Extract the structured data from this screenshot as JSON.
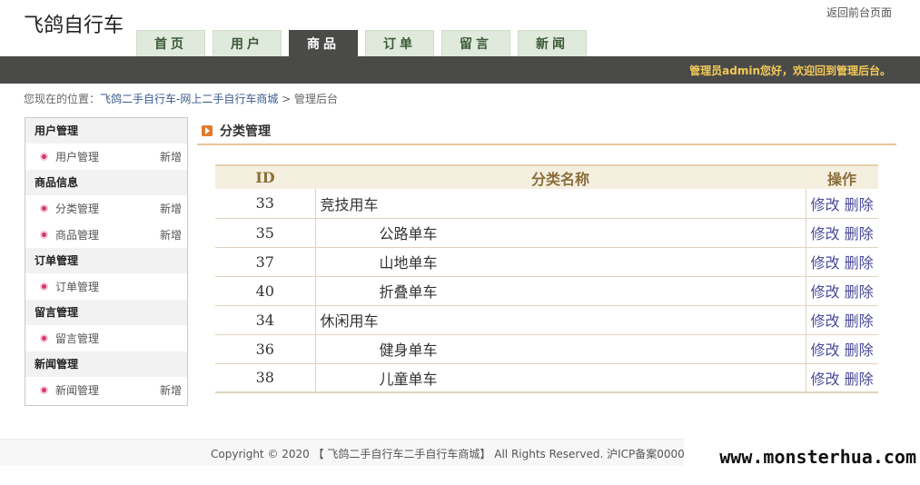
{
  "brand": "飞鸽自行车",
  "top_link": "返回前台页面",
  "nav": [
    {
      "label": "首页",
      "active": false
    },
    {
      "label": "用户",
      "active": false
    },
    {
      "label": "商品",
      "active": true
    },
    {
      "label": "订单",
      "active": false
    },
    {
      "label": "留言",
      "active": false
    },
    {
      "label": "新闻",
      "active": false
    }
  ],
  "welcome": "管理员admin您好，欢迎回到管理后台。",
  "breadcrumb": {
    "prefix": "您现在的位置：",
    "site": "飞鸽二手自行车-网上二手自行车商城",
    "sep": " > ",
    "current": "管理后台"
  },
  "sidebar": [
    {
      "group": "用户管理",
      "items": [
        {
          "label": "用户管理",
          "add": "新增"
        }
      ]
    },
    {
      "group": "商品信息",
      "items": [
        {
          "label": "分类管理",
          "add": "新增"
        },
        {
          "label": "商品管理",
          "add": "新增"
        }
      ]
    },
    {
      "group": "订单管理",
      "items": [
        {
          "label": "订单管理",
          "add": ""
        }
      ]
    },
    {
      "group": "留言管理",
      "items": [
        {
          "label": "留言管理",
          "add": ""
        }
      ]
    },
    {
      "group": "新闻管理",
      "items": [
        {
          "label": "新闻管理",
          "add": "新增"
        }
      ]
    }
  ],
  "section_title": "分类管理",
  "table": {
    "headers": [
      "ID",
      "分类名称",
      "操作"
    ],
    "rows": [
      {
        "id": "33",
        "name": "竞技用车",
        "sub": false
      },
      {
        "id": "35",
        "name": "公路单车",
        "sub": true
      },
      {
        "id": "37",
        "name": "山地单车",
        "sub": true
      },
      {
        "id": "40",
        "name": "折叠单车",
        "sub": true
      },
      {
        "id": "34",
        "name": "休闲用车",
        "sub": false
      },
      {
        "id": "36",
        "name": "健身单车",
        "sub": true
      },
      {
        "id": "38",
        "name": "儿童单车",
        "sub": true
      }
    ],
    "edit_label": "修改",
    "delete_label": "删除"
  },
  "footer": "Copyright © 2020 【 飞鸽二手自行车二手自行车商城】 All Rights Reserved. 沪ICP备案0000",
  "watermark": "www.monsterhua.com"
}
